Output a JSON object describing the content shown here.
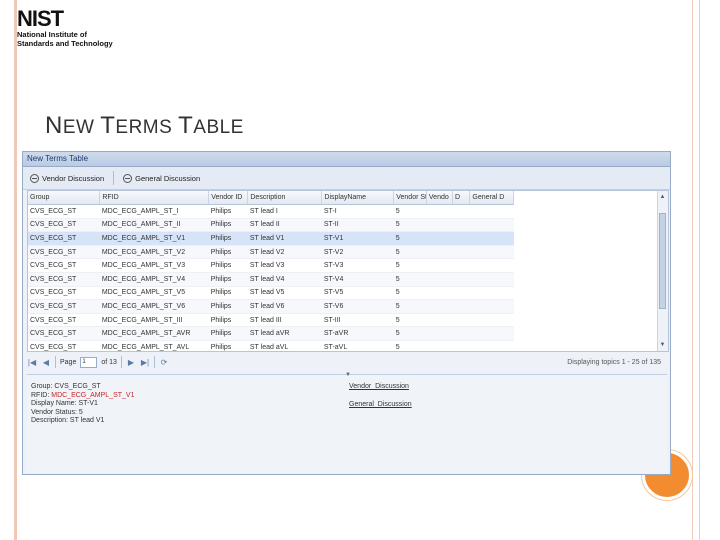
{
  "logo": {
    "mark": "NIST",
    "line1": "National Institute of",
    "line2": "Standards and Technology"
  },
  "slide": {
    "title_part1_big": "N",
    "title_part1_small": "EW ",
    "title_part2_big": "T",
    "title_part2_small": "ERMS ",
    "title_part3_big": "T",
    "title_part3_small": "ABLE"
  },
  "app": {
    "window_title": "New Terms Table",
    "toolbar": {
      "vendor_discussion": "Vendor Discussion",
      "general_discussion": "General Discussion"
    },
    "columns": [
      "Group",
      "RFID",
      "Vendor ID",
      "Description",
      "DisplayName",
      "Vendor St",
      "Vendo",
      "D",
      "General D"
    ],
    "rows": [
      [
        "CVS_ECG_ST",
        "MDC_ECG_AMPL_ST_I",
        "Philips",
        "ST lead I",
        "ST-I",
        "5",
        "",
        "",
        ""
      ],
      [
        "CVS_ECG_ST",
        "MDC_ECG_AMPL_ST_II",
        "Philips",
        "ST lead II",
        "ST-II",
        "5",
        "",
        "",
        ""
      ],
      [
        "CVS_ECG_ST",
        "MDC_ECG_AMPL_ST_V1",
        "Philips",
        "ST lead V1",
        "ST-V1",
        "5",
        "",
        "",
        ""
      ],
      [
        "CVS_ECG_ST",
        "MDC_ECG_AMPL_ST_V2",
        "Philips",
        "ST lead V2",
        "ST-V2",
        "5",
        "",
        "",
        ""
      ],
      [
        "CVS_ECG_ST",
        "MDC_ECG_AMPL_ST_V3",
        "Philips",
        "ST lead V3",
        "ST-V3",
        "5",
        "",
        "",
        ""
      ],
      [
        "CVS_ECG_ST",
        "MDC_ECG_AMPL_ST_V4",
        "Philips",
        "ST lead V4",
        "ST-V4",
        "5",
        "",
        "",
        ""
      ],
      [
        "CVS_ECG_ST",
        "MDC_ECG_AMPL_ST_V5",
        "Philips",
        "ST lead V5",
        "ST-V5",
        "5",
        "",
        "",
        ""
      ],
      [
        "CVS_ECG_ST",
        "MDC_ECG_AMPL_ST_V6",
        "Philips",
        "ST lead V6",
        "ST-V6",
        "5",
        "",
        "",
        ""
      ],
      [
        "CVS_ECG_ST",
        "MDC_ECG_AMPL_ST_III",
        "Philips",
        "ST lead III",
        "ST-III",
        "5",
        "",
        "",
        ""
      ],
      [
        "CVS_ECG_ST",
        "MDC_ECG_AMPL_ST_AVR",
        "Philips",
        "ST lead aVR",
        "ST-aVR",
        "5",
        "",
        "",
        ""
      ],
      [
        "CVS_ECG_ST",
        "MDC_ECG_AMPL_ST_AVL",
        "Philips",
        "ST lead aVL",
        "ST-aVL",
        "5",
        "",
        "",
        ""
      ]
    ],
    "selected_row": 2,
    "pager": {
      "page_label": "Page",
      "page_value": "1",
      "of_label": "of 13",
      "display": "Displaying topics 1 - 25 of 135"
    },
    "detail": {
      "group_label": "Group:",
      "group_value": "CVS_ECG_ST",
      "rfid_label": "RFID:",
      "rfid_value": "MDC_ECG_AMPL_ST_V1",
      "display_label": "Display Name:",
      "display_value": "ST-V1",
      "status_label": "Vendor Status:",
      "status_value": "5",
      "desc_label": "Description:",
      "desc_value": "ST lead V1",
      "vendor_discussion": "Vendor_Discussion",
      "general_discussion": "General_Discussion"
    }
  },
  "colors": {
    "accent": "#f38b2f",
    "rfid_text": "#c62828",
    "selected_row": "#d7e4f7"
  }
}
